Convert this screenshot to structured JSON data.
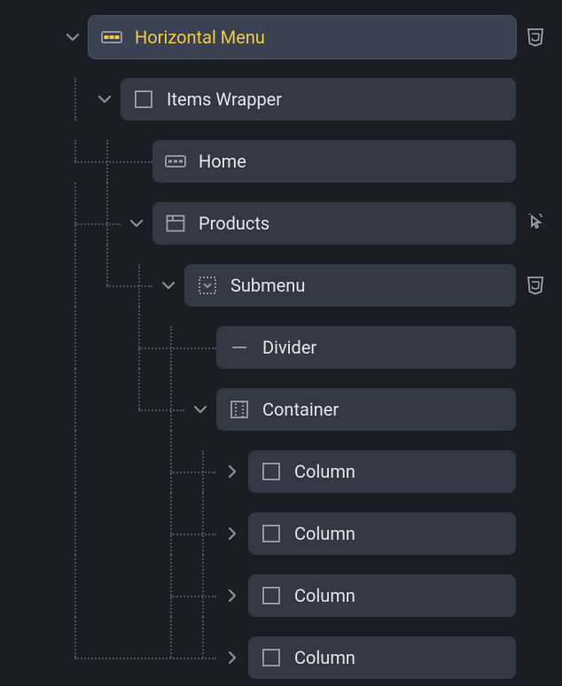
{
  "tree": {
    "root": {
      "label": "Horizontal Menu",
      "icon": "nav-icon",
      "badge": "css3-icon"
    },
    "items_wrapper": {
      "label": "Items Wrapper",
      "icon": "box-icon"
    },
    "home": {
      "label": "Home",
      "icon": "nav-icon"
    },
    "products": {
      "label": "Products",
      "icon": "section-icon",
      "badge": "cursor-icon"
    },
    "submenu": {
      "label": "Submenu",
      "icon": "dropdown-icon",
      "badge": "css3-icon"
    },
    "divider": {
      "label": "Divider",
      "icon": "line-icon"
    },
    "container": {
      "label": "Container",
      "icon": "container-icon"
    },
    "columns": [
      {
        "label": "Column",
        "icon": "box-icon"
      },
      {
        "label": "Column",
        "icon": "box-icon"
      },
      {
        "label": "Column",
        "icon": "box-icon"
      },
      {
        "label": "Column",
        "icon": "box-icon"
      }
    ]
  }
}
